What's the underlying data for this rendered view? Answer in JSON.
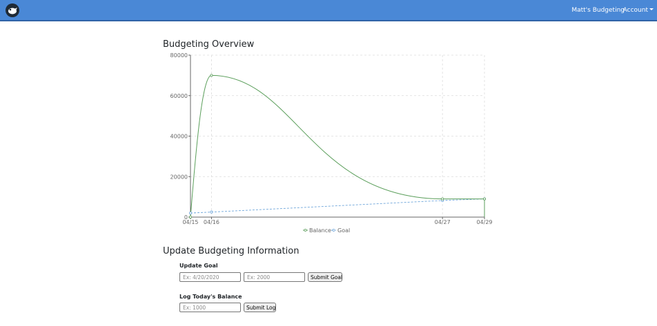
{
  "navbar": {
    "logo_icon": "cartoon-bird-logo-icon",
    "user_label": "Matt's Budgeting",
    "account_label": "Account",
    "bg_color": "#4a88d6"
  },
  "overview": {
    "title": "Budgeting Overview"
  },
  "chart_data": {
    "type": "line",
    "x": [
      "04/15",
      "04/16",
      "04/27",
      "04/29"
    ],
    "series": [
      {
        "name": "Balance",
        "values": [
          0,
          70000,
          9000,
          9000
        ],
        "color": "#5a9e5a"
      },
      {
        "name": "Goal",
        "values": [
          2000,
          2500,
          8200,
          9000
        ],
        "color": "#6aa3d9",
        "dashed": true
      }
    ],
    "yticks": [
      "0",
      "20000",
      "40000",
      "60000",
      "80000"
    ],
    "ylim": [
      0,
      80000
    ],
    "grid": true,
    "legend": "bottom-center"
  },
  "update": {
    "title": "Update Budgeting Information",
    "goal": {
      "label": "Update Goal",
      "date_placeholder": "Ex: 4/20/2020",
      "amount_placeholder": "Ex: 2000",
      "submit_label": "Submit Goal"
    },
    "log": {
      "label": "Log Today's Balance",
      "balance_placeholder": "Ex: 1000",
      "submit_label": "Submit Log"
    }
  }
}
